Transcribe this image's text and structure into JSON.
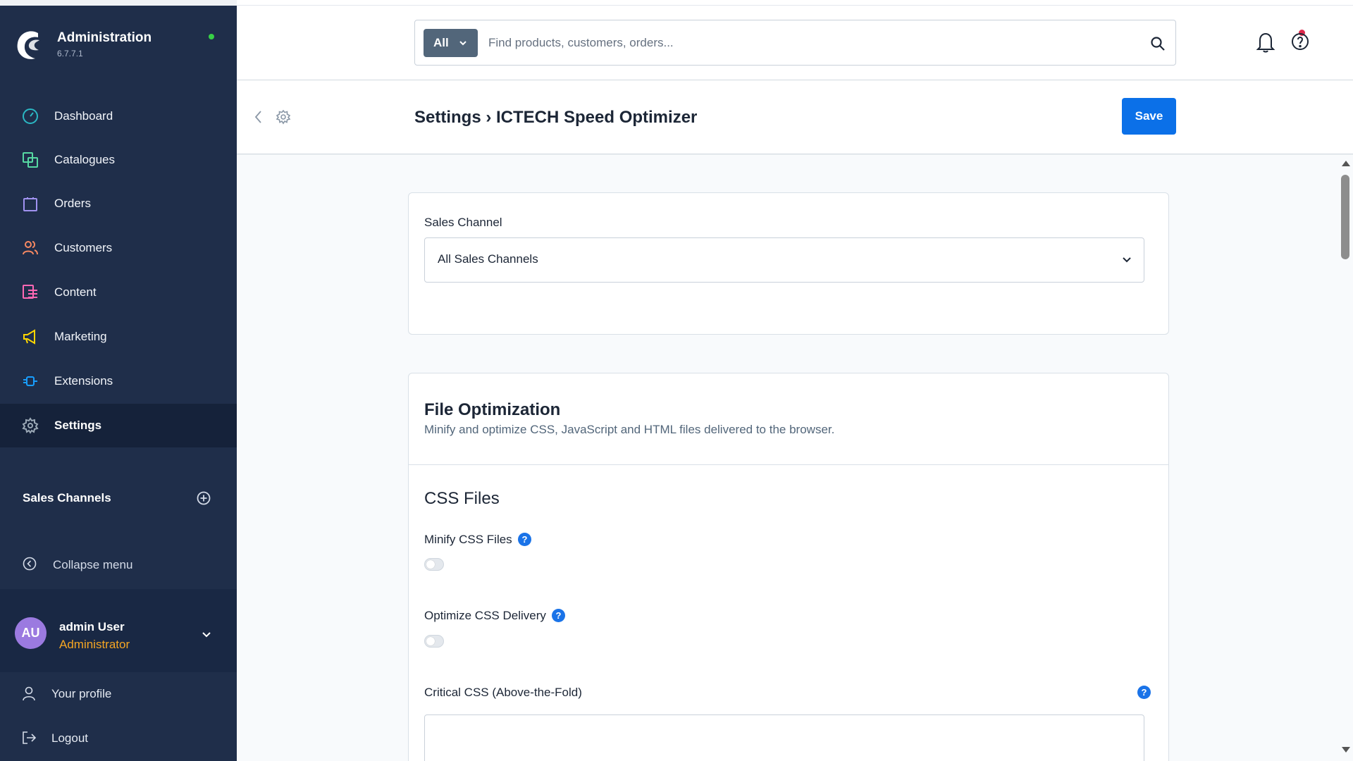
{
  "brand": {
    "title": "Administration",
    "version": "6.7.7.1",
    "status_color": "#37d046"
  },
  "sidebar": {
    "items": [
      {
        "label": "Dashboard",
        "icon": "dashboard-icon",
        "color": "#2bb8c4"
      },
      {
        "label": "Catalogues",
        "icon": "catalogues-icon",
        "color": "#57d9a3"
      },
      {
        "label": "Orders",
        "icon": "orders-icon",
        "color": "#a092f0"
      },
      {
        "label": "Customers",
        "icon": "customers-icon",
        "color": "#f88962"
      },
      {
        "label": "Content",
        "icon": "content-icon",
        "color": "#ff68b4"
      },
      {
        "label": "Marketing",
        "icon": "marketing-icon",
        "color": "#ffd700"
      },
      {
        "label": "Extensions",
        "icon": "extensions-icon",
        "color": "#189eff"
      },
      {
        "label": "Settings",
        "icon": "settings-icon",
        "color": "#9aa8b5",
        "active": true
      }
    ],
    "sales_channels_title": "Sales Channels",
    "collapse_label": "Collapse menu"
  },
  "user": {
    "initials": "AU",
    "name": "admin User",
    "role": "Administrator",
    "role_color": "#f5a623"
  },
  "account_menu": {
    "profile_label": "Your profile",
    "logout_label": "Logout"
  },
  "search": {
    "type_label": "All",
    "placeholder": "Find products, customers, orders..."
  },
  "header": {
    "title": "Settings › ICTECH Speed Optimizer",
    "save_label": "Save",
    "accent_color": "#0b70e8"
  },
  "sales_channel_card": {
    "label": "Sales Channel",
    "selected": "All Sales Channels"
  },
  "file_optimization": {
    "title": "File Optimization",
    "description": "Minify and optimize CSS, JavaScript and HTML files delivered to the browser.",
    "css_section_title": "CSS Files",
    "fields": {
      "minify_css": {
        "label": "Minify CSS Files",
        "enabled": false
      },
      "optimize_css_delivery": {
        "label": "Optimize CSS Delivery",
        "enabled": false
      },
      "critical_css": {
        "label": "Critical CSS (Above-the-Fold)",
        "value": ""
      }
    },
    "help_glyph": "?"
  }
}
